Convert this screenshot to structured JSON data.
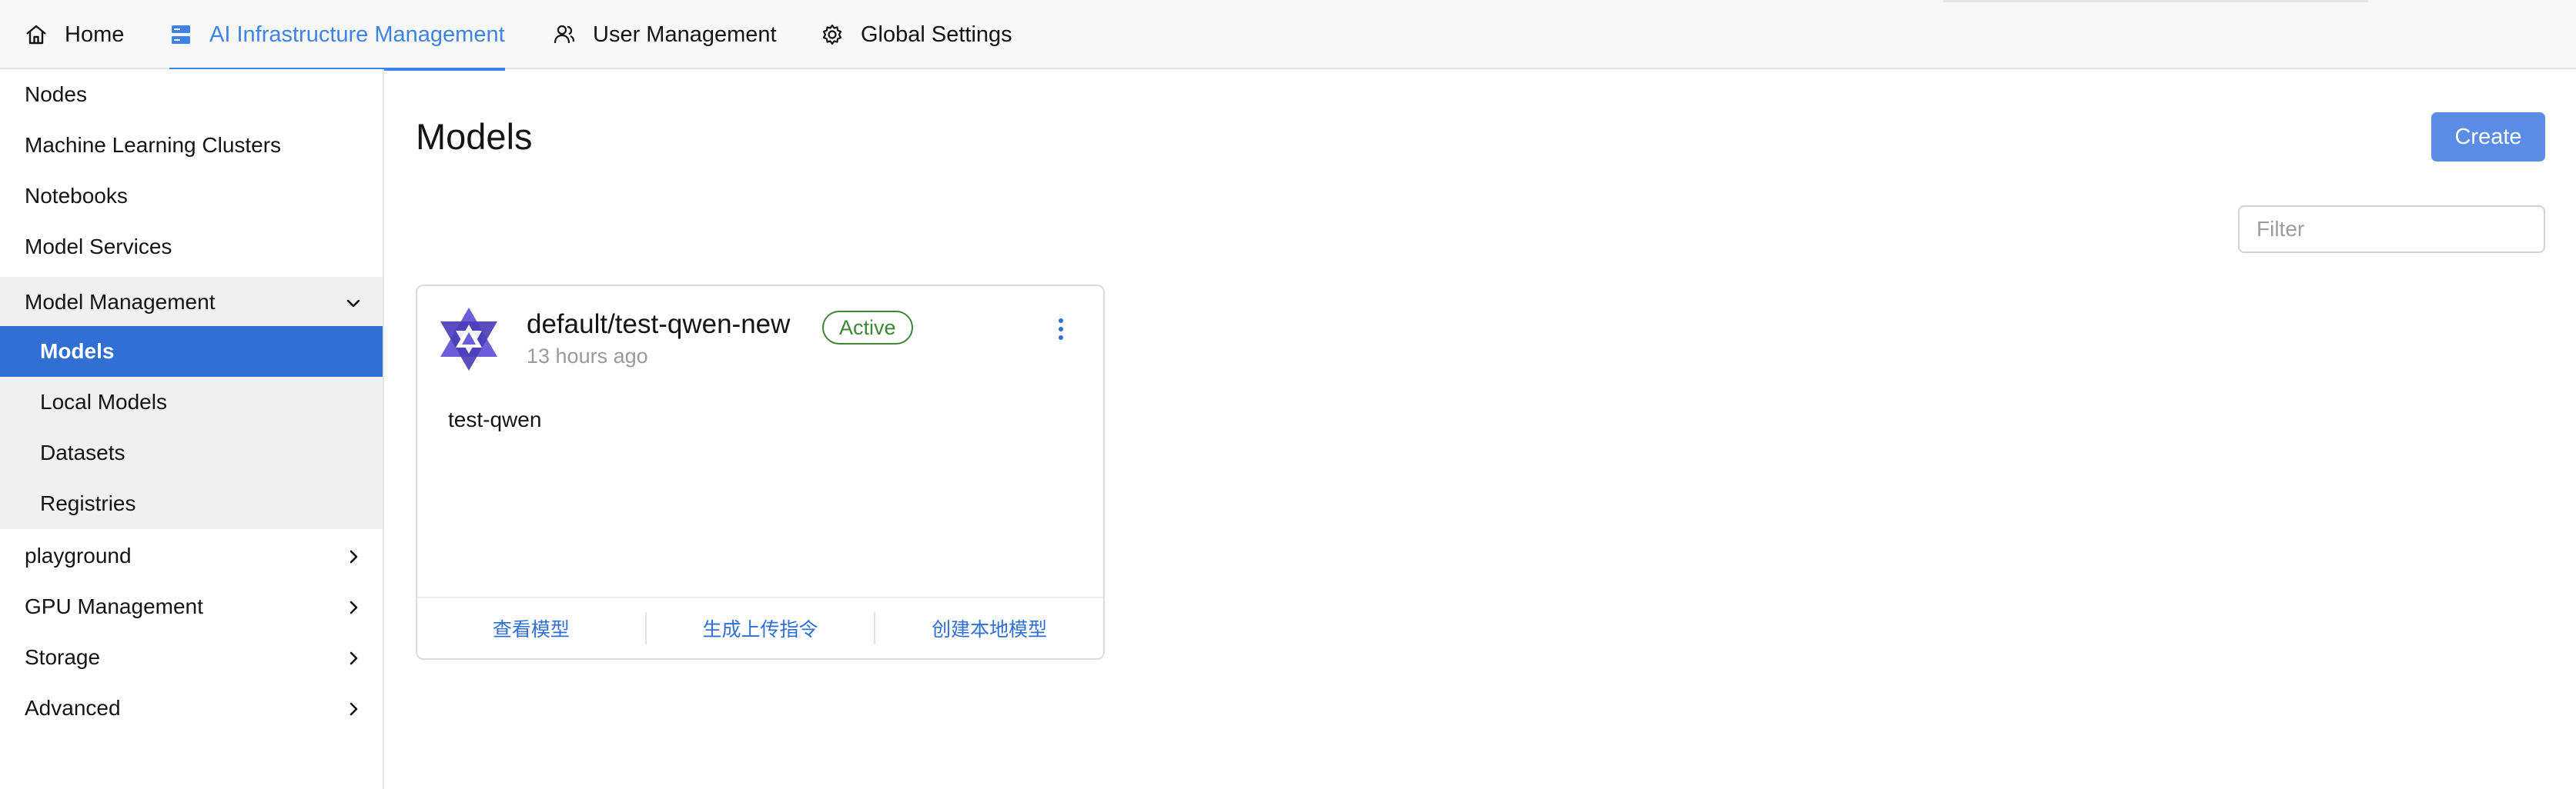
{
  "topnav": {
    "tabs": [
      {
        "label": "Home",
        "icon": "home-icon"
      },
      {
        "label": "AI Infrastructure Management",
        "icon": "server-icon",
        "active": true
      },
      {
        "label": "User Management",
        "icon": "users-icon"
      },
      {
        "label": "Global Settings",
        "icon": "gear-icon"
      }
    ],
    "accent_color": "#3f82e8"
  },
  "sidebar": {
    "items": [
      {
        "label": "Nodes"
      },
      {
        "label": "Machine Learning Clusters"
      },
      {
        "label": "Notebooks"
      },
      {
        "label": "Model Services"
      }
    ],
    "group": {
      "label": "Model Management",
      "expanded": true,
      "children": [
        {
          "label": "Models",
          "selected": true
        },
        {
          "label": "Local Models"
        },
        {
          "label": "Datasets"
        },
        {
          "label": "Registries"
        }
      ]
    },
    "collapsed_groups": [
      {
        "label": "playground"
      },
      {
        "label": "GPU Management"
      },
      {
        "label": "Storage"
      },
      {
        "label": "Advanced"
      }
    ]
  },
  "main": {
    "title": "Models",
    "create_label": "Create",
    "filter_placeholder": "Filter",
    "cards": [
      {
        "name": "default/test-qwen-new",
        "status": "Active",
        "time": "13 hours ago",
        "description": "test-qwen",
        "actions": [
          "查看模型",
          "生成上传指令",
          "创建本地模型"
        ]
      }
    ]
  }
}
